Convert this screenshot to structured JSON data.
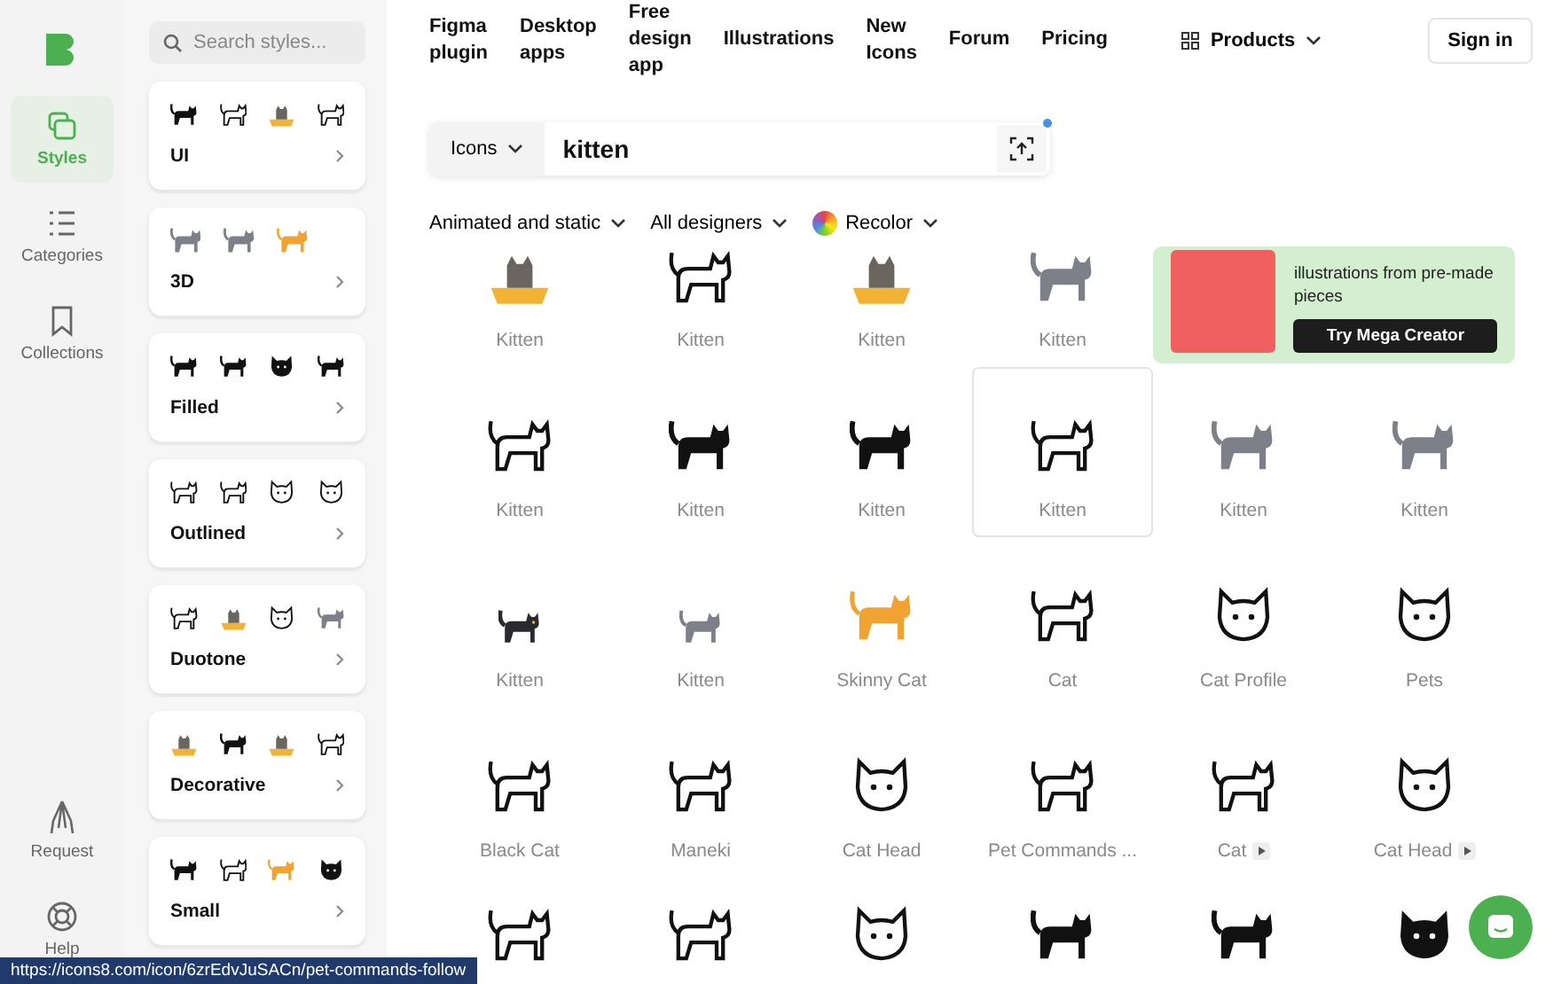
{
  "rail": {
    "items": [
      {
        "label": "Styles",
        "selected": true
      },
      {
        "label": "Categories",
        "selected": false
      },
      {
        "label": "Collections",
        "selected": false
      }
    ],
    "bottom_items": [
      {
        "label": "Request"
      },
      {
        "label": "Help"
      }
    ]
  },
  "styles_panel": {
    "search": {
      "placeholder": "Search styles..."
    },
    "styles": [
      {
        "name": "UI",
        "icons": [
          {
            "kind": "filled"
          },
          {
            "kind": "outline"
          },
          {
            "kind": "box"
          },
          {
            "kind": "outline"
          }
        ]
      },
      {
        "name": "3D",
        "icons": [
          {
            "kind": "grey"
          },
          {
            "kind": "grey"
          },
          {
            "kind": "orange"
          }
        ]
      },
      {
        "name": "Filled",
        "icons": [
          {
            "kind": "filled"
          },
          {
            "kind": "filled"
          },
          {
            "kind": "head-filled"
          },
          {
            "kind": "filled"
          }
        ]
      },
      {
        "name": "Outlined",
        "icons": [
          {
            "kind": "outline"
          },
          {
            "kind": "outline"
          },
          {
            "kind": "head"
          },
          {
            "kind": "head"
          }
        ]
      },
      {
        "name": "Duotone",
        "icons": [
          {
            "kind": "outline"
          },
          {
            "kind": "box"
          },
          {
            "kind": "head"
          },
          {
            "kind": "grey"
          }
        ]
      },
      {
        "name": "Decorative",
        "icons": [
          {
            "kind": "box"
          },
          {
            "kind": "filled"
          },
          {
            "kind": "box"
          },
          {
            "kind": "outline"
          }
        ]
      },
      {
        "name": "Small",
        "icons": [
          {
            "kind": "filled"
          },
          {
            "kind": "outline"
          },
          {
            "kind": "orange"
          },
          {
            "kind": "head-filled"
          }
        ]
      }
    ]
  },
  "nav": {
    "links": [
      "Figma plugin",
      "Desktop apps",
      "Free design app",
      "Illustrations",
      "New Icons",
      "Forum",
      "Pricing"
    ],
    "products": "Products",
    "sign_in": "Sign in"
  },
  "search": {
    "type": "Icons",
    "query": "kitten"
  },
  "filters": [
    {
      "label": "Animated and static",
      "kind": "plain"
    },
    {
      "label": "All designers",
      "kind": "plain"
    },
    {
      "label": "Recolor",
      "kind": "recolor"
    }
  ],
  "promo": {
    "text": "illustrations from pre-made pieces",
    "button": "Try Mega Creator"
  },
  "results": [
    {
      "label": "Kitten",
      "kind": "box",
      "hovered": false,
      "animated": false
    },
    {
      "label": "Kitten",
      "kind": "outline",
      "hovered": false,
      "animated": false
    },
    {
      "label": "Kitten",
      "kind": "box",
      "hovered": false,
      "animated": false
    },
    {
      "label": "Kitten",
      "kind": "grey",
      "hovered": false,
      "animated": false
    },
    {
      "label": "Kitten",
      "kind": "outline",
      "hovered": false,
      "animated": false
    },
    {
      "label": "Kitten",
      "kind": "filled",
      "hovered": false,
      "animated": false
    },
    {
      "label": "Kitten",
      "kind": "filled",
      "hovered": false,
      "animated": false
    },
    {
      "label": "Kitten",
      "kind": "outline",
      "hovered": true,
      "animated": false
    },
    {
      "label": "Kitten",
      "kind": "grey",
      "hovered": false,
      "animated": false
    },
    {
      "label": "Kitten",
      "kind": "grey",
      "hovered": false,
      "animated": false
    },
    {
      "label": "Kitten",
      "kind": "dark",
      "hovered": false,
      "animated": false
    },
    {
      "label": "Kitten",
      "kind": "grey",
      "hovered": false,
      "animated": false
    },
    {
      "label": "Skinny Cat",
      "kind": "orange",
      "hovered": false,
      "animated": false
    },
    {
      "label": "Cat",
      "kind": "outline",
      "hovered": false,
      "animated": false
    },
    {
      "label": "Cat Profile",
      "kind": "head",
      "hovered": false,
      "animated": false
    },
    {
      "label": "Pets",
      "kind": "head",
      "hovered": false,
      "animated": false
    },
    {
      "label": "Black Cat",
      "kind": "outline",
      "hovered": false,
      "animated": false
    },
    {
      "label": "Maneki",
      "kind": "outline",
      "hovered": false,
      "animated": false
    },
    {
      "label": "Cat Head",
      "kind": "head",
      "hovered": false,
      "animated": false
    },
    {
      "label": "Pet Commands ...",
      "kind": "outline",
      "hovered": false,
      "animated": false
    },
    {
      "label": "Cat",
      "kind": "outline",
      "hovered": false,
      "animated": true
    },
    {
      "label": "Cat Head",
      "kind": "head",
      "hovered": false,
      "animated": true
    },
    {
      "kind": "outline",
      "hovered": false,
      "animated": false
    },
    {
      "kind": "outline",
      "hovered": false,
      "animated": false
    },
    {
      "kind": "head",
      "hovered": false,
      "animated": false
    },
    {
      "kind": "filled",
      "hovered": false,
      "animated": false
    },
    {
      "kind": "filled",
      "hovered": false,
      "animated": false
    },
    {
      "kind": "head-filled",
      "hovered": false,
      "animated": false
    }
  ],
  "status_url": "https://icons8.com/icon/6zrEdvJuSACn/pet-commands-follow"
}
